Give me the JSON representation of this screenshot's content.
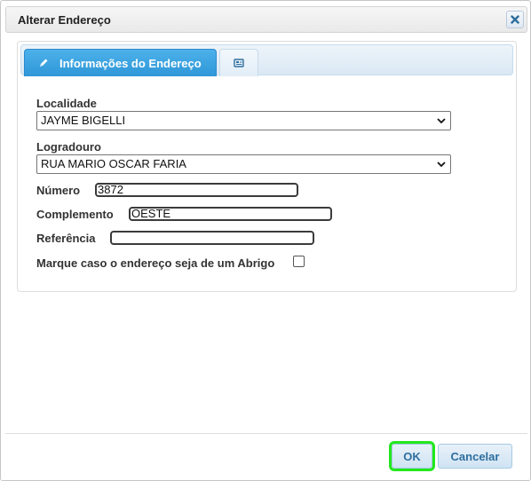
{
  "dialog": {
    "title": "Alterar Endereço",
    "close_icon": "close-icon"
  },
  "tabs": [
    {
      "label": "Informações do Endereço",
      "icon": "pencil-icon",
      "active": true
    },
    {
      "label": "",
      "icon": "card-icon",
      "active": false
    }
  ],
  "form": {
    "localidade": {
      "label": "Localidade",
      "value": "JAYME BIGELLI"
    },
    "logradouro": {
      "label": "Logradouro",
      "value": "RUA MARIO OSCAR FARIA"
    },
    "numero": {
      "label": "Número",
      "value": "3872"
    },
    "complemento": {
      "label": "Complemento",
      "value": "OESTE"
    },
    "referencia": {
      "label": "Referência",
      "value": ""
    },
    "abrigo": {
      "label": "Marque caso o endereço seja de um Abrigo",
      "checked": false
    }
  },
  "buttons": {
    "ok": "OK",
    "cancel": "Cancelar"
  },
  "colors": {
    "tab_active": "#2f97d8",
    "button_text": "#2e6e9e",
    "focus_outline": "#22e81d"
  }
}
